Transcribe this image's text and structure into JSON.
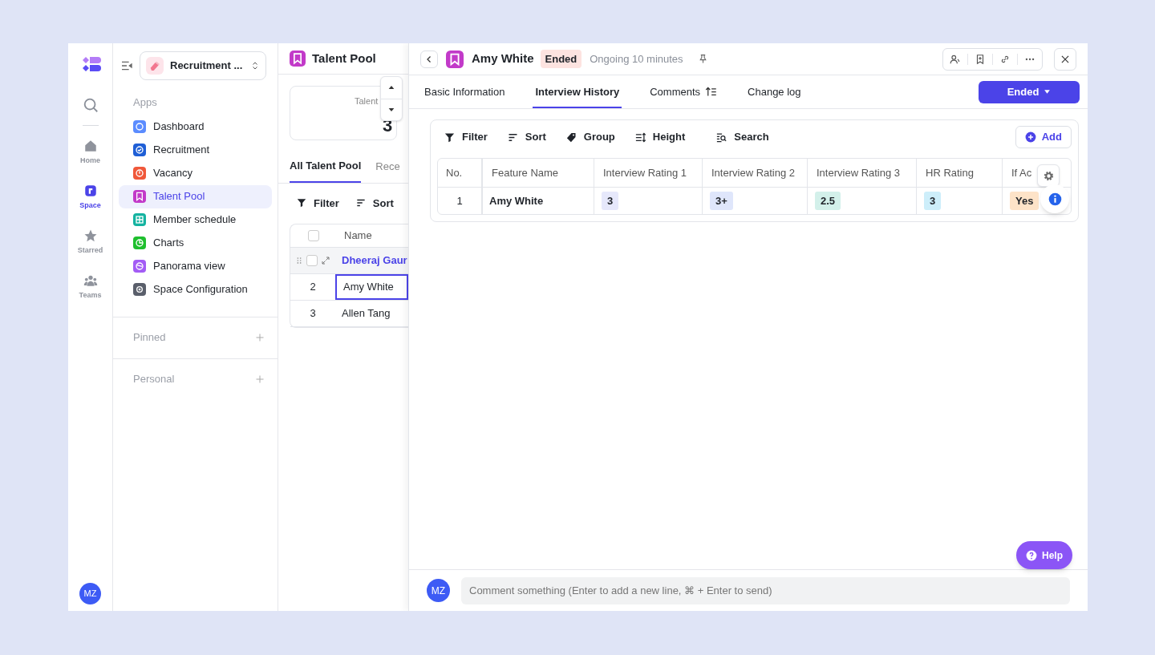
{
  "rail": {
    "items": [
      {
        "label": "Home",
        "selected": false
      },
      {
        "label": "Space",
        "selected": true
      },
      {
        "label": "Starred",
        "selected": false
      },
      {
        "label": "Teams",
        "selected": false
      }
    ],
    "avatar": "MZ"
  },
  "sidebar": {
    "workspace": "Recruitment ...",
    "section": "Apps",
    "items": [
      {
        "label": "Dashboard",
        "color": "#5b8cff",
        "selected": false
      },
      {
        "label": "Recruitment",
        "color": "#1f5fd6",
        "selected": false
      },
      {
        "label": "Vacancy",
        "color": "#f0583a",
        "selected": false
      },
      {
        "label": "Talent Pool",
        "color": "#c23ac9",
        "selected": true
      },
      {
        "label": "Member schedule",
        "color": "#14b3a0",
        "selected": false
      },
      {
        "label": "Charts",
        "color": "#1fbf2e",
        "selected": false
      },
      {
        "label": "Panorama view",
        "color": "#a35cf5",
        "selected": false
      },
      {
        "label": "Space Configuration",
        "color": "#5a5f6b",
        "selected": false
      }
    ],
    "groups": [
      "Pinned",
      "Personal"
    ]
  },
  "list": {
    "title": "Talent Pool",
    "stat": {
      "label": "Talent",
      "value": "3"
    },
    "tabs": [
      {
        "label": "All Talent Pool",
        "selected": true
      },
      {
        "label": "Rece",
        "selected": false
      }
    ],
    "tools": [
      "Filter",
      "Sort"
    ],
    "select_all": {
      "checked": false
    },
    "column": "Name",
    "rows": [
      {
        "no": "",
        "name": "Dheeraj Gaur",
        "selected": false,
        "hovered": true,
        "checked": false
      },
      {
        "no": "2",
        "name": "Amy White",
        "selected": true,
        "hovered": false,
        "checked": false
      },
      {
        "no": "3",
        "name": "Allen Tang",
        "selected": false,
        "hovered": false,
        "checked": false
      }
    ]
  },
  "detail": {
    "title": "Amy White",
    "badge": "Ended",
    "status": "Ongoing 10 minutes",
    "tabs": [
      {
        "label": "Basic Information",
        "selected": false
      },
      {
        "label": "Interview History",
        "selected": true
      },
      {
        "label": "Comments",
        "selected": false
      },
      {
        "label": "Change log",
        "selected": false
      }
    ],
    "stage_button": "Ended",
    "toolbar": [
      "Filter",
      "Sort",
      "Group",
      "Height",
      "Search"
    ],
    "add": "Add",
    "table": {
      "columns": [
        "No.",
        "Feature Name",
        "Interview Rating 1",
        "Interview Rating 2",
        "Interview Rating 3",
        "HR Rating",
        "If Ac"
      ],
      "rows": [
        {
          "no": "1",
          "name": "Amy White",
          "tags": [
            {
              "text": "3",
              "color": "#e6e8fb"
            },
            {
              "text": "3+",
              "color": "#dfe6fb"
            },
            {
              "text": "2.5",
              "color": "#d3f0ea"
            },
            {
              "text": "3",
              "color": "#cdeefa"
            },
            {
              "text": "Yes",
              "color": "#fde3c8"
            }
          ]
        }
      ]
    },
    "help": "Help",
    "comment": {
      "avatar": "MZ",
      "placeholder": "Comment something (Enter to add a new line, ⌘ + Enter to send)"
    }
  }
}
